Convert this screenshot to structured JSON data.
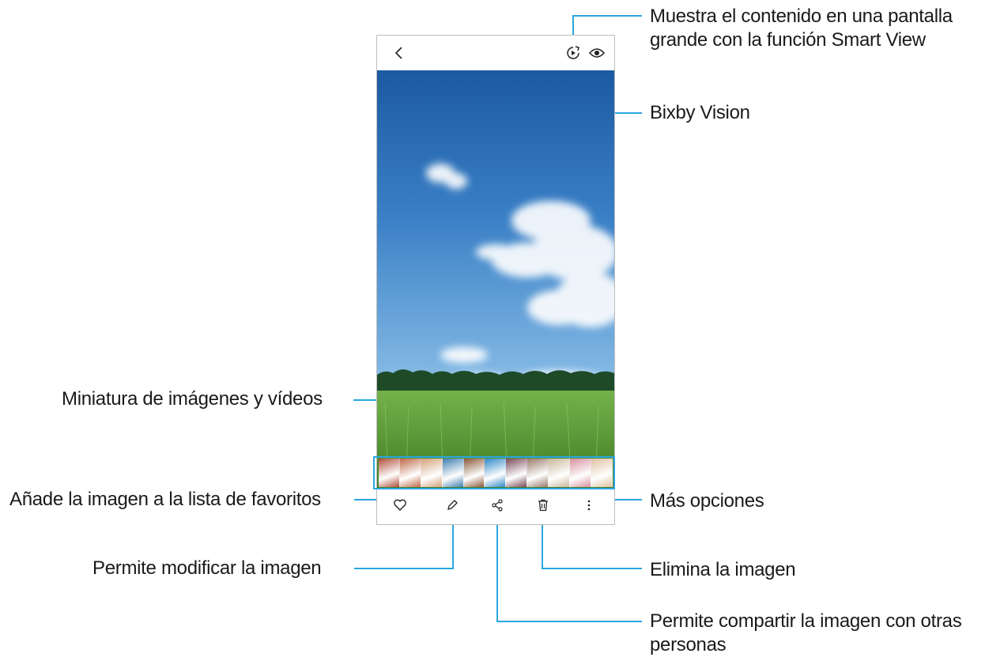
{
  "callouts": {
    "smart_view_line1": "Muestra el contenido en una pantalla",
    "smart_view_line2": "grande con la función Smart View",
    "bixby_vision": "Bixby Vision",
    "thumbnails": "Miniatura de imágenes y vídeos",
    "favorites": "Añade la imagen a la lista de favoritos",
    "more_options": "Más opciones",
    "edit": "Permite modificar la imagen",
    "delete": "Elimina la imagen",
    "share_line1": "Permite compartir la imagen con otras",
    "share_line2": "personas"
  },
  "icons": {
    "back": "chevron-left-icon",
    "smart_view": "smart-view-icon",
    "bixby_vision": "eye-icon",
    "favorite": "heart-icon",
    "edit": "pencil-icon",
    "share": "share-icon",
    "delete": "trash-icon",
    "more": "more-vertical-icon"
  },
  "thumbnails": [
    {
      "color": "#b0503a"
    },
    {
      "color": "#c06a4a"
    },
    {
      "color": "#d4a27a"
    },
    {
      "color": "#3f7fb0"
    },
    {
      "color": "#8a5a3a"
    },
    {
      "color": "#2f88c8"
    },
    {
      "color": "#7a4a5a"
    },
    {
      "color": "#9a7a6a"
    },
    {
      "color": "#c9b89a"
    },
    {
      "color": "#d890a0"
    },
    {
      "color": "#e0c0a0"
    }
  ],
  "colors": {
    "callout_line": "#2aa7e0",
    "sky_top": "#1f5fa6",
    "sky_mid": "#4a8fd0",
    "sky_low": "#8fc0e8",
    "field": "#5aa03a",
    "trees": "#1f4a2a"
  }
}
